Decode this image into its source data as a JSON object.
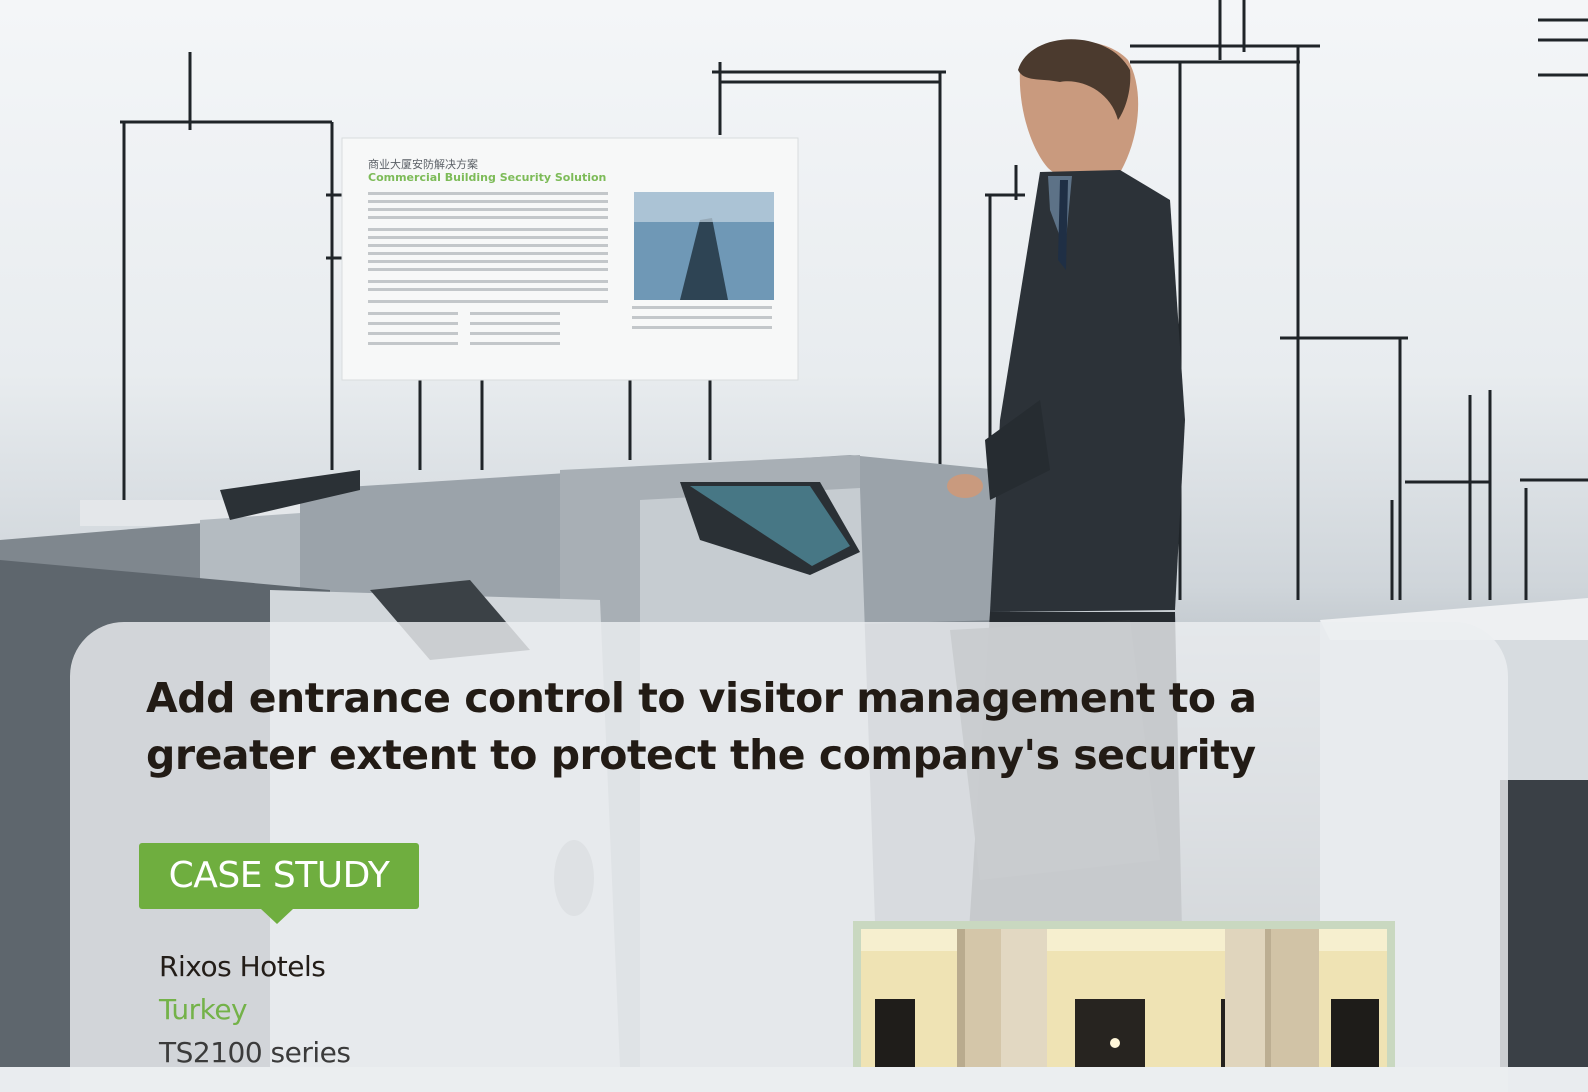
{
  "hero": {
    "image_name": "turnstile-lobby-photo"
  },
  "card": {
    "headline": "Add entrance control to visitor management to a greater extent to protect the company's security",
    "badge_label": "CASE STUDY",
    "client": "Rixos Hotels",
    "country": "Turkey",
    "product": "TS2100 series"
  },
  "wall_sign": {
    "title_cn": "商业大厦安防解决方案",
    "title_en": "Commercial Building Security Solution"
  },
  "colors": {
    "accent_green": "#6fae3f",
    "country_green": "#74b249",
    "headline_text": "#221b15"
  }
}
